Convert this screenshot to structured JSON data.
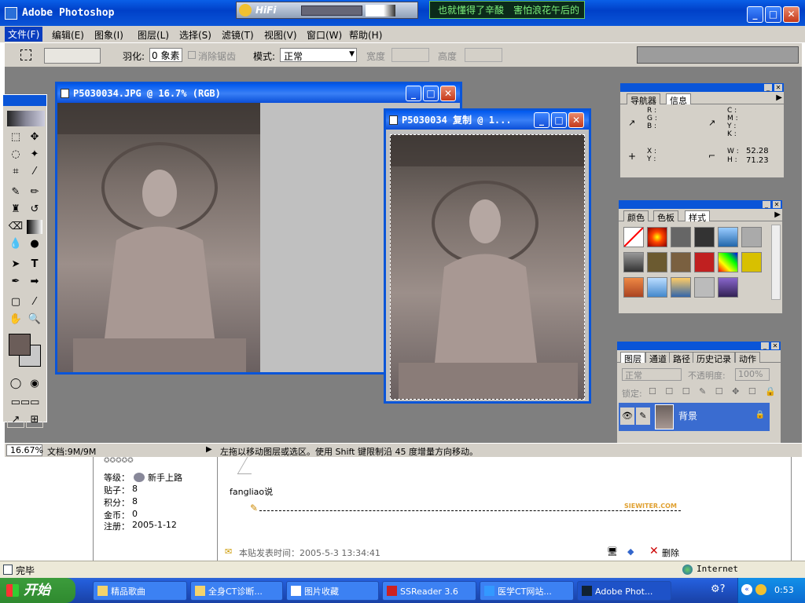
{
  "app": {
    "title": "Adobe Photoshop",
    "hifi": "HiFi",
    "song": "也就懂得了辛酸　害怕浪花午后的"
  },
  "menu": [
    "文件(F)",
    "编辑(E)",
    "图象(I)",
    "图层(L)",
    "选择(S)",
    "滤镜(T)",
    "视图(V)",
    "窗口(W)",
    "帮助(H)"
  ],
  "options": {
    "feather_label": "羽化:",
    "feather_value": "0 象素",
    "antialias": "消除锯齿",
    "mode_label": "模式:",
    "mode_value": "正常",
    "width_label": "宽度",
    "height_label": "高度"
  },
  "doc1": {
    "title": "P5030034.JPG @ 16.7% (RGB)"
  },
  "doc2": {
    "title": "P5030034 复制 @ 1..."
  },
  "navigator": {
    "tabs": [
      "导航器",
      "信息"
    ],
    "rgb": "R :\nG :\nB :",
    "cmyk": "C :\nM :\nY :\nK :",
    "xy": "X :\nY :",
    "w_label": "W :",
    "h_label": "H :",
    "w_value": "52.28",
    "h_value": "71.23"
  },
  "color": {
    "tabs": [
      "颜色",
      "色板",
      "样式"
    ]
  },
  "layers": {
    "tabs": [
      "图层",
      "通道",
      "路径",
      "历史记录",
      "动作"
    ],
    "blend": "正常",
    "opacity_label": "不透明度:",
    "opacity_value": "100%",
    "lock_label": "锁定:",
    "layer_name": "背景"
  },
  "status": {
    "zoom": "16.67%",
    "doc": "文档:9M/9M",
    "hint": "左拖以移动图层或选区。使用 Shift 键限制沿 45 度增量方向移动。"
  },
  "forum": {
    "level_label": "等级：",
    "level_value": "新手上路",
    "posts_label": "贴子：",
    "posts_value": "8",
    "points_label": "积分：",
    "points_value": "8",
    "coins_label": "金币：",
    "coins_value": "0",
    "reg_label": "注册：",
    "reg_value": "2005-1-12",
    "said": "fangliao说",
    "site": "SIEWITER.COM",
    "posttime": "本贴发表时间：2005-5-3 13:34:41",
    "delete": "删除"
  },
  "ie": {
    "done": "完毕",
    "zone": "Internet"
  },
  "taskbar": {
    "start": "开始",
    "items": [
      "精品歌曲",
      "全身CT诊断...",
      "图片收藏",
      "SSReader 3.6",
      "医学CT网站...",
      "Adobe Phot..."
    ],
    "time": "0:53"
  },
  "colors": {
    "xpblue": "#0a55d8",
    "panel": "#d4d0c8",
    "work": "#7f7f7f",
    "taskbar": "#245edb",
    "start": "#3a9b3a"
  }
}
